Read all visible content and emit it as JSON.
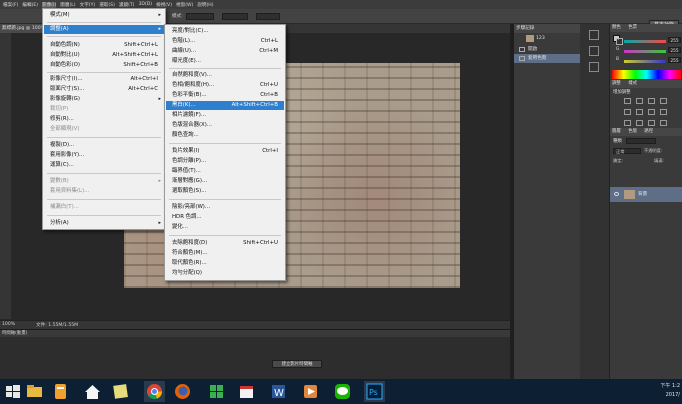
{
  "menubar": {
    "items": [
      "檔案(F)",
      "編輯(E)",
      "影像(I)",
      "圖層(L)",
      "文字(Y)",
      "選取(S)",
      "濾鏡(T)",
      "3D(D)",
      "檢視(V)",
      "視窗(W)",
      "說明(H)"
    ]
  },
  "options": {
    "workspace": "基本功能",
    "mode_label": "模式:"
  },
  "document": {
    "tab_title": "無標題.jpg @ 100% (RGB/8)",
    "zoom": "100%",
    "doc_size": "文件: 1.55M/1.55M"
  },
  "timeline": {
    "title": "時間軸(動畫)",
    "create_button": "建立影片時間軸"
  },
  "history": {
    "title": "步驟記錄",
    "snapshot": "123",
    "items": [
      "開啟",
      "套用色階"
    ]
  },
  "right_panel": {
    "color_tab": "顏色",
    "swatches_tab": "色票",
    "adjust_tab": "調整",
    "styles_tab": "樣式",
    "adjust_sub": "增加調整",
    "layers_tab": "圖層",
    "channels_tab": "色版",
    "paths_tab": "路徑",
    "kind_label": "種類",
    "blend_mode": "正常",
    "opacity": "不透明度:",
    "lock": "鎖定:",
    "fill": "填滿:",
    "layer_name": "背景",
    "r_label": "R",
    "g_label": "G",
    "b_label": "B",
    "r_value": "255",
    "g_value": "255",
    "b_value": "255"
  },
  "image_menu": [
    {
      "label": "模式(M)",
      "arrow": "▸"
    },
    {
      "label": "調整(A)",
      "arrow": "▸"
    },
    {
      "label": "自動色調(N)",
      "shortcut": "Shift+Ctrl+L"
    },
    {
      "label": "自動對比(U)",
      "shortcut": "Alt+Shift+Ctrl+L"
    },
    {
      "label": "自動色彩(O)",
      "shortcut": "Shift+Ctrl+B"
    },
    {
      "label": "影像尺寸(I)...",
      "shortcut": "Alt+Ctrl+I"
    },
    {
      "label": "版面尺寸(S)...",
      "shortcut": "Alt+Ctrl+C"
    },
    {
      "label": "影像旋轉(G)",
      "arrow": "▸"
    },
    {
      "label": "裁切(P)"
    },
    {
      "label": "修剪(R)..."
    },
    {
      "label": "全部顯現(V)"
    },
    {
      "label": "複製(D)..."
    },
    {
      "label": "套用影像(Y)..."
    },
    {
      "label": "運算(C)..."
    },
    {
      "label": "變數(B)",
      "arrow": "▸"
    },
    {
      "label": "套用資料集(L)..."
    },
    {
      "label": "補漏白(T)..."
    },
    {
      "label": "分析(A)",
      "arrow": "▸"
    }
  ],
  "adjust_menu": [
    {
      "label": "亮度/對比(C)..."
    },
    {
      "label": "色階(L)...",
      "shortcut": "Ctrl+L"
    },
    {
      "label": "曲線(U)...",
      "shortcut": "Ctrl+M"
    },
    {
      "label": "曝光度(E)..."
    },
    {
      "label": "自然飽和度(V)..."
    },
    {
      "label": "色相/飽和度(H)...",
      "shortcut": "Ctrl+U"
    },
    {
      "label": "色彩平衡(B)...",
      "shortcut": "Ctrl+B"
    },
    {
      "label": "黑白(K)...",
      "shortcut": "Alt+Shift+Ctrl+B"
    },
    {
      "label": "相片濾鏡(F)..."
    },
    {
      "label": "色版混合器(X)..."
    },
    {
      "label": "顏色查詢..."
    },
    {
      "label": "負片效果(I)",
      "shortcut": "Ctrl+I"
    },
    {
      "label": "色調分離(P)..."
    },
    {
      "label": "臨界值(T)..."
    },
    {
      "label": "漸層對應(G)..."
    },
    {
      "label": "選取顏色(S)..."
    },
    {
      "label": "陰影/亮部(W)..."
    },
    {
      "label": "HDR 色調..."
    },
    {
      "label": "變化..."
    },
    {
      "label": "去除飽和度(D)",
      "shortcut": "Shift+Ctrl+U"
    },
    {
      "label": "符合顏色(M)..."
    },
    {
      "label": "取代顏色(R)..."
    },
    {
      "label": "均勻分配(Q)"
    }
  ],
  "taskbar": {
    "clock_time": "下午 1:2",
    "clock_date": "2017/"
  },
  "colors": {
    "highlight": "#2f7fcf",
    "selection": "#5d6e86",
    "taskbar": "#0c1f33"
  }
}
